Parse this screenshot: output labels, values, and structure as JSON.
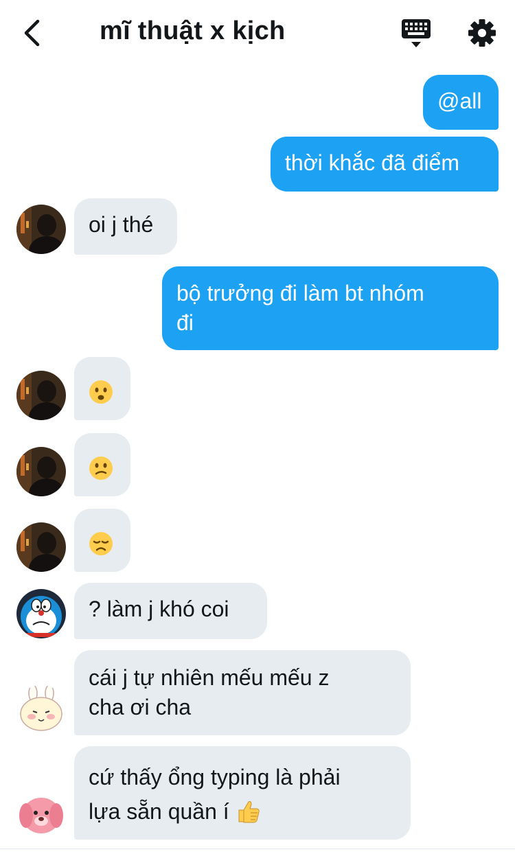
{
  "header": {
    "title": "mĩ thuật x kịch"
  },
  "messages": [
    {
      "side": "out",
      "text": "@all"
    },
    {
      "side": "out",
      "text": "thời khắc đã điểm"
    },
    {
      "side": "in",
      "sender": "user-1",
      "text": "oi j thé"
    },
    {
      "side": "out",
      "lines": [
        "bộ trưởng đi làm bt nhóm",
        "đi"
      ]
    },
    {
      "side": "in",
      "sender": "user-1",
      "emoji": "frowning-face"
    },
    {
      "side": "in",
      "sender": "user-1",
      "emoji": "confused-face"
    },
    {
      "side": "in",
      "sender": "user-1",
      "emoji": "disappointed-face"
    },
    {
      "side": "in",
      "sender": "user-2",
      "text": "? làm j khó coi"
    },
    {
      "side": "in",
      "sender": "user-3",
      "lines": [
        "cái j tự nhiên mếu mếu z",
        "cha ơi cha"
      ]
    },
    {
      "side": "in",
      "sender": "user-4",
      "lines": [
        "cứ thấy ổng typing là phải",
        "lựa sẵn quần í"
      ],
      "trailing_emoji": "thumbs-up"
    }
  ],
  "colors": {
    "outgoing_bubble": "#1da1f2",
    "incoming_bubble": "#e6ecf0",
    "text": "#14171a"
  }
}
